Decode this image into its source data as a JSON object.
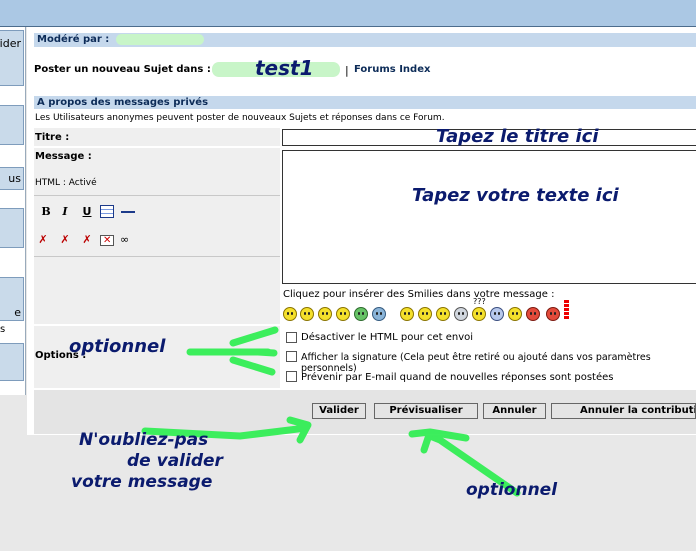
{
  "left": {
    "items": [
      "ider",
      "",
      "us",
      "",
      "e",
      "s",
      ""
    ]
  },
  "moderated_by": "Modéré par :",
  "post_in": "Poster un nouveau Sujet dans :",
  "forum_name": "test1",
  "forums_index_sep": "|",
  "forums_index": "Forums Index",
  "private_msgs": "A propos des messages privés",
  "anon_notice": "Les Utilisateurs anonymes peuvent poster de nouveaux Sujets et réponses dans ce Forum.",
  "title_label": "Titre :",
  "title_value": "Tapez le titre ici",
  "message_label": "Message :",
  "html_status": "HTML : Activé",
  "message_value": "Tapez votre texte ici",
  "format": {
    "b": "B",
    "i": "I",
    "u": "U"
  },
  "smilies_hint": "Cliquez pour insérer des Smilies dans votre message :",
  "options_label": "Options :",
  "options": [
    "Désactiver le HTML pour cet envoi",
    "Afficher la signature (Cela peut être retiré ou ajouté dans vos paramètres personnels)",
    "Prévenir par E-mail quand de nouvelles réponses sont postées"
  ],
  "buttons": {
    "submit": "Valider",
    "preview": "Prévisualiser",
    "cancel": "Annuler",
    "cancel_contrib": "Annuler la contribution"
  },
  "annotations": {
    "optionnel_options": "optionnel",
    "validate_line1": "N'oubliez-pas",
    "validate_line2": "de valider",
    "validate_line3": "votre message",
    "optionnel_preview": "optionnel"
  },
  "colors": {
    "topband": "#abc8e4",
    "category": "#c5d8ec",
    "annotation": "#0b1b6e",
    "arrow": "#33ee55"
  }
}
